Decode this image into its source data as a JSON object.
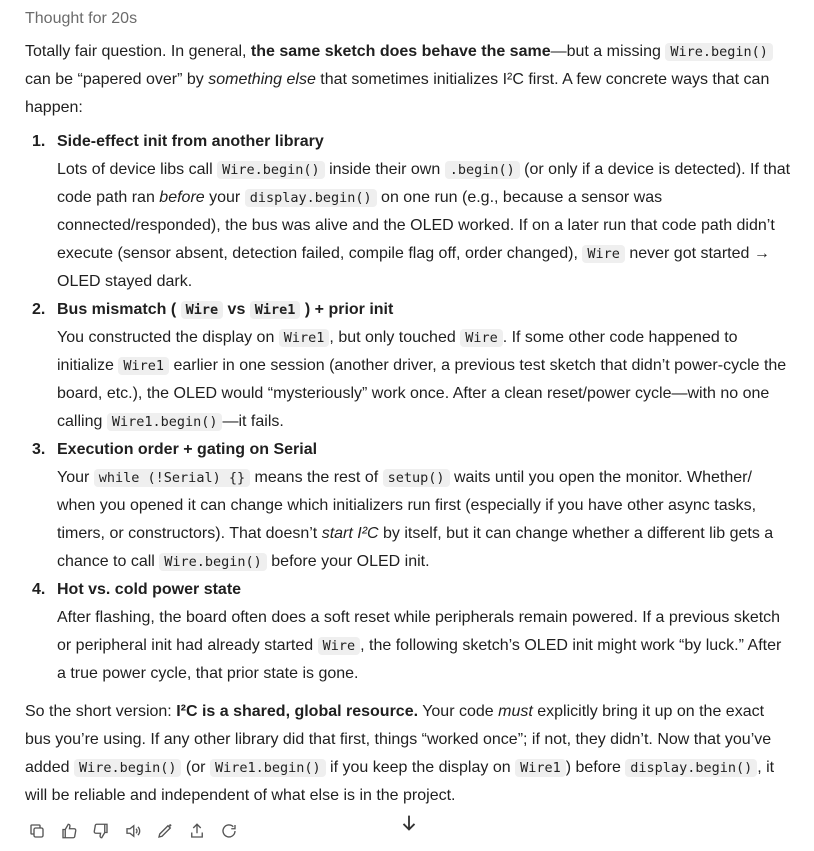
{
  "thought_label": "Thought for 20s",
  "intro": {
    "t1": "Totally fair question. In general, ",
    "b1": "the same sketch does behave the same",
    "t2": "—but a missing ",
    "c1": "Wire.begin()",
    "t3": " can be “papered over” by ",
    "i1": "something else",
    "t4": " that sometimes initializes I²C first. A few concrete ways that can happen:"
  },
  "items": [
    {
      "num": "1.",
      "title": "Side-effect init from another library",
      "p1": "Lots of device libs call ",
      "c1": "Wire.begin()",
      "p2": " inside their own ",
      "c2": ".begin()",
      "p3": " (or only if a device is detected). If that code path ran ",
      "i1": "before",
      "p4": " your ",
      "c3": "display.begin()",
      "p5": " on one run (e.g., because a sensor was connected/responded), the bus was alive and the OLED worked. If on a later run that code path didn’t execute (sensor absent, detection failed, compile flag off, order changed), ",
      "c4": "Wire",
      "p6": " never got started → OLED stayed dark."
    },
    {
      "num": "2.",
      "title_a": "Bus mismatch ( ",
      "title_c1": "Wire",
      "title_b": " vs ",
      "title_c2": "Wire1",
      "title_d": " ) + prior init",
      "p1": "You constructed the display on ",
      "c1": "Wire1",
      "p2": ", but only touched ",
      "c2": "Wire",
      "p3": ". If some other code happened to initialize ",
      "c3": "Wire1",
      "p4": " earlier in one session (another driver, a previous test sketch that didn’t power-cycle the board, etc.), the OLED would “mysteriously” work once. After a clean reset/power cycle—with no one calling ",
      "c4": "Wire1.begin()",
      "p5": "—it fails."
    },
    {
      "num": "3.",
      "title": "Execution order + gating on Serial",
      "p1": "Your ",
      "c1": "while (!Serial) {}",
      "p2": " means the rest of ",
      "c2": "setup()",
      "p3": " waits until you open the monitor. Whether/ when you opened it can change which initializers run first (especially if you have other async tasks, timers, or constructors). That doesn’t ",
      "i1": "start I²C",
      "p4": " by itself, but it can change whether a different lib gets a chance to call ",
      "c3": "Wire.begin()",
      "p5": " before your OLED init."
    },
    {
      "num": "4.",
      "title": "Hot vs. cold power state",
      "p1": "After flashing, the board often does a soft reset while peripherals remain powered. If a previous sketch or peripheral init had already started ",
      "c1": "Wire",
      "p2": ", the following sketch’s OLED init might work “by luck.” After a true power cycle, that prior state is gone."
    }
  ],
  "closing": {
    "t1": "So the short version: ",
    "b1": "I²C is a shared, global resource.",
    "t2": " Your code ",
    "i1": "must",
    "t3": " explicitly bring it up on the exact bus you’re using. If any other library did that first, things “worked once”; if not, they didn’t. Now that you’ve added ",
    "c1": "Wire.begin()",
    "t4": " (or ",
    "c2": "Wire1.begin()",
    "t5": " if you keep the display on ",
    "c3": "Wire1",
    "t6": ") before ",
    "c4": "display.begin()",
    "t7": ", it will be reliable and independent of what else is in the project."
  },
  "toolbar_icons": [
    "copy-icon",
    "thumbs-up-icon",
    "thumbs-down-icon",
    "speaker-icon",
    "edit-icon",
    "share-icon",
    "regenerate-icon"
  ],
  "scroll_icon": "arrow-down-icon"
}
